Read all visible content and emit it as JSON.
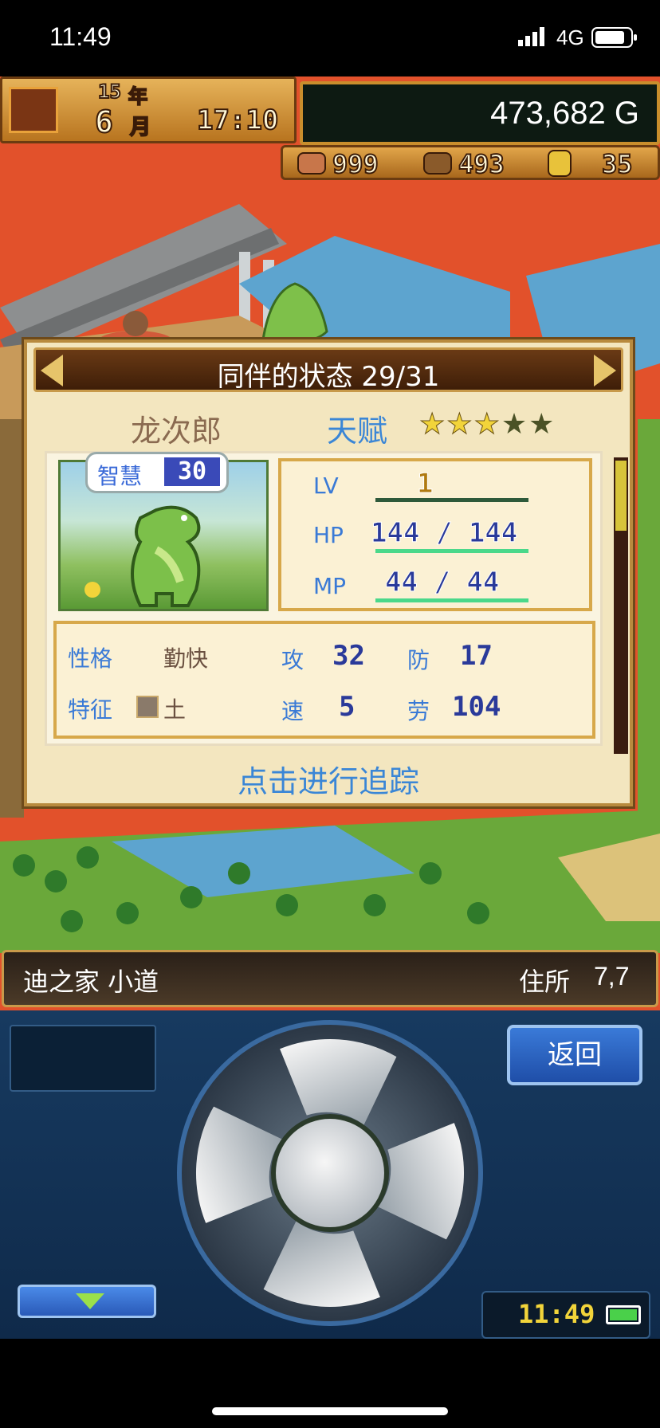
{
  "status_bar": {
    "time": "11:49",
    "network": "4G"
  },
  "hud": {
    "year_num": "15",
    "year_unit": "年",
    "month_num": "6",
    "month_unit": "月",
    "clock": "17:10",
    "gold": "473,682 G",
    "resources": [
      {
        "icon": "meat-icon",
        "value": "999"
      },
      {
        "icon": "wood-icon",
        "value": "493"
      },
      {
        "icon": "gold-ore-icon",
        "value": "35"
      }
    ]
  },
  "dialog": {
    "title": "同伴的状态 29/31",
    "name": "龙次郎",
    "talent_label": "天赋",
    "talent_stars": 3,
    "talent_max": 5,
    "tooltip": {
      "label": "智慧",
      "value": "30"
    },
    "stats": {
      "lv_label": "LV",
      "lv": "1",
      "hp_label": "HP",
      "hp": "144 / 144",
      "mp_label": "MP",
      "mp": "44 / 44"
    },
    "attributes": {
      "personality_label": "性格",
      "personality": "勤快",
      "trait_label": "特征",
      "trait": "土",
      "attack_label": "攻",
      "attack": "32",
      "defense_label": "防",
      "defense": "17",
      "speed_label": "速",
      "speed": "5",
      "labor_label": "劳",
      "labor": "104"
    },
    "track_button": "点击进行追踪"
  },
  "location": {
    "name": "迪之家 小道",
    "coord_label": "住所",
    "coord": "7,7"
  },
  "controller": {
    "back_label": "返回",
    "clock": "11:49"
  }
}
